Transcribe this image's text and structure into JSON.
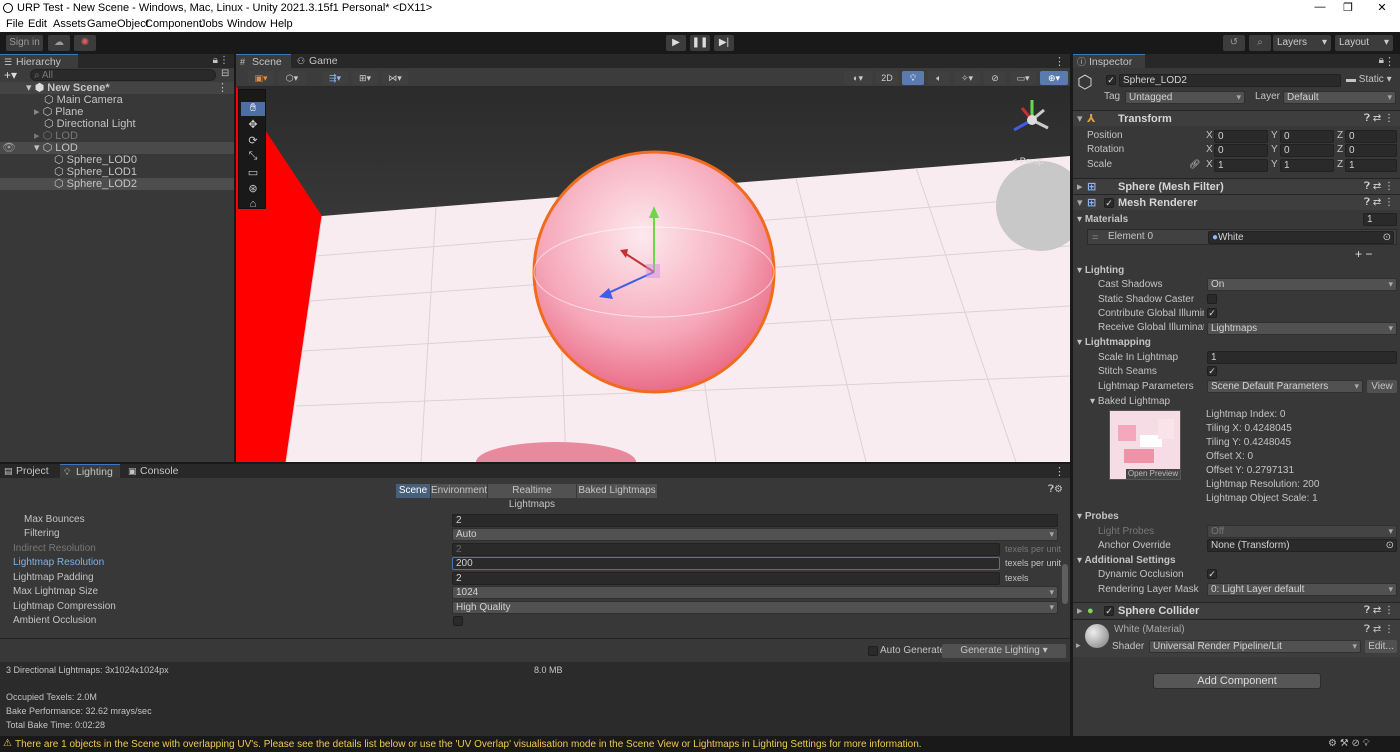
{
  "window": {
    "title": "URP Test - New Scene - Windows, Mac, Linux - Unity 2021.3.15f1 Personal* <DX11>",
    "minimize": "—",
    "maximize": "❐",
    "close": "✕"
  },
  "menu": [
    "File",
    "Edit",
    "Assets",
    "GameObject",
    "Component",
    "Jobs",
    "Window",
    "Help"
  ],
  "toolbar": {
    "signin": "Sign in",
    "layers": "Layers",
    "layout": "Layout"
  },
  "hierarchy": {
    "tab": "Hierarchy",
    "search_placeholder": "All",
    "items": [
      {
        "label": "New Scene*"
      },
      {
        "label": "Main Camera"
      },
      {
        "label": "Plane"
      },
      {
        "label": "Directional Light"
      },
      {
        "label": "LOD"
      },
      {
        "label": "LOD"
      },
      {
        "label": "Sphere_LOD0"
      },
      {
        "label": "Sphere_LOD1"
      },
      {
        "label": "Sphere_LOD2"
      }
    ]
  },
  "scene": {
    "tabs": [
      "Scene",
      "Game"
    ],
    "twod": "2D",
    "persp": "< Persp"
  },
  "inspector": {
    "tab": "Inspector",
    "name": "Sphere_LOD2",
    "static": "Static",
    "tag_label": "Tag",
    "tag": "Untagged",
    "layer_label": "Layer",
    "layer": "Default",
    "transform": {
      "title": "Transform",
      "position": "Position",
      "rotation": "Rotation",
      "scale": "Scale",
      "pos": [
        "0",
        "0",
        "0"
      ],
      "rot": [
        "0",
        "0",
        "0"
      ],
      "scl": [
        "1",
        "1",
        "1"
      ],
      "axes": [
        "X",
        "Y",
        "Z"
      ]
    },
    "mesh_filter": "Sphere (Mesh Filter)",
    "mesh_renderer": "Mesh Renderer",
    "materials": {
      "title": "Materials",
      "count": "1",
      "element": "Element 0",
      "value": "White"
    },
    "lighting": {
      "title": "Lighting",
      "cast": "Cast Shadows",
      "cast_val": "On",
      "static_caster": "Static Shadow Caster",
      "contribute": "Contribute Global Illuminati",
      "receive": "Receive Global Illuminatio",
      "receive_val": "Lightmaps"
    },
    "lightmapping": {
      "title": "Lightmapping",
      "scale": "Scale In Lightmap",
      "scale_val": "1",
      "stitch": "Stitch Seams",
      "params": "Lightmap Parameters",
      "params_val": "Scene Default Parameters",
      "view": "View",
      "baked": "Baked Lightmap",
      "open_preview": "Open Preview",
      "info": [
        "Lightmap Index: 0",
        "Tiling X: 0.4248045",
        "Tiling Y: 0.4248045",
        "Offset X: 0",
        "Offset Y: 0.2797131",
        "Lightmap Resolution: 200",
        "Lightmap Object Scale: 1"
      ]
    },
    "probes": {
      "title": "Probes",
      "light_probes": "Light Probes",
      "light_probes_val": "Off",
      "anchor": "Anchor Override",
      "anchor_val": "None (Transform)"
    },
    "additional": {
      "title": "Additional Settings",
      "dynamic": "Dynamic Occlusion",
      "mask": "Rendering Layer Mask",
      "mask_val": "0: Light Layer default"
    },
    "collider": "Sphere Collider",
    "material_name": "White (Material)",
    "shader_label": "Shader",
    "shader": "Universal Render Pipeline/Lit",
    "edit": "Edit...",
    "add_component": "Add Component"
  },
  "bottom": {
    "tabs": [
      "Project",
      "Lighting",
      "Console"
    ],
    "subtabs": [
      "Scene",
      "Environment",
      "Realtime Lightmaps",
      "Baked Lightmaps"
    ],
    "rows": [
      {
        "label": "Max Bounces",
        "value": "2",
        "unit": ""
      },
      {
        "label": "Filtering",
        "value": "Auto",
        "unit": ""
      },
      {
        "label": "Indirect Resolution",
        "value": "2",
        "unit": "texels per unit"
      },
      {
        "label": "Lightmap Resolution",
        "value": "200",
        "unit": "texels per unit"
      },
      {
        "label": "Lightmap Padding",
        "value": "2",
        "unit": "texels"
      },
      {
        "label": "Max Lightmap Size",
        "value": "1024",
        "unit": ""
      },
      {
        "label": "Lightmap Compression",
        "value": "High Quality",
        "unit": ""
      },
      {
        "label": "Ambient Occlusion",
        "value": "",
        "unit": ""
      }
    ],
    "auto_generate": "Auto Generate",
    "generate": "Generate Lighting",
    "stats": [
      "3 Directional Lightmaps: 3x1024x1024px",
      "Occupied Texels: 2.0M",
      "Bake Performance: 32.62 mrays/sec",
      "Total Bake Time: 0:02:28"
    ],
    "size": "8.0 MB"
  },
  "status": "There are 1 objects in the Scene with overlapping UV's. Please see the details list below or use the 'UV Overlap' visualisation mode in the Scene View or Lightmaps in Lighting Settings for more information."
}
